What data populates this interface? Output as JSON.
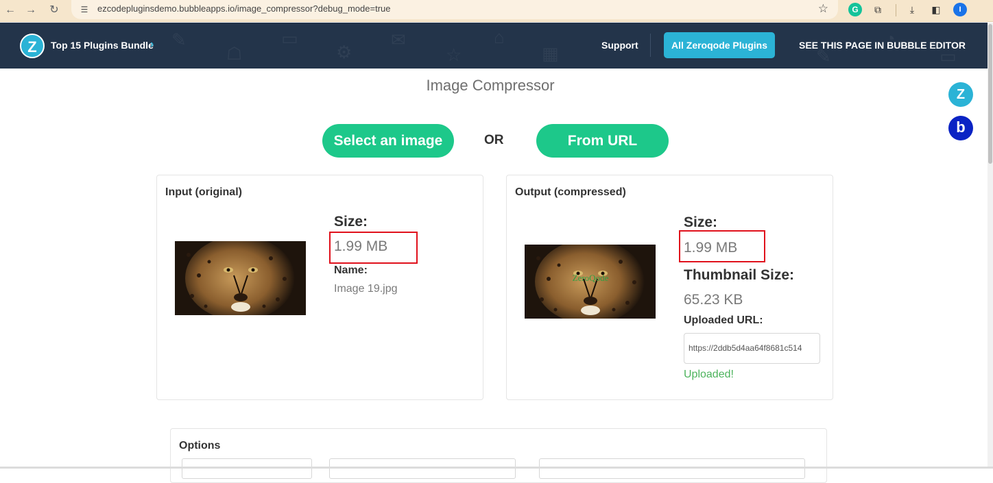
{
  "browser": {
    "url": "ezcodepluginsdemo.bubbleapps.io/image_compressor?debug_mode=true",
    "profile_initial": "I",
    "icons": [
      "back-icon",
      "forward-icon",
      "reload-icon",
      "site-settings-icon",
      "bookmark-star-icon",
      "grammarly-icon",
      "extensions-icon",
      "download-icon",
      "sidebar-icon",
      "profile-icon"
    ]
  },
  "header": {
    "logo_letter": "Z",
    "bundle_label": "Top 15 Plugins Bundle",
    "bundle_chevron": "›",
    "support_label": "Support",
    "all_plugins_label": "All Zeroqode Plugins",
    "editor_label": "SEE THIS PAGE IN BUBBLE EDITOR",
    "colors": {
      "background": "#23344a",
      "accent": "#2bb3d6"
    }
  },
  "page": {
    "title": "Image Compressor",
    "select_button": "Select an image",
    "or_label": "OR",
    "url_button": "From URL",
    "side_z_letter": "Z",
    "side_b_letter": "b",
    "button_color": "#1dc88a"
  },
  "input_card": {
    "title": "Input (original)",
    "size_label": "Size:",
    "size_value": "1.99 MB",
    "name_label": "Name:",
    "name_value": "Image 19.jpg"
  },
  "output_card": {
    "title": "Output (compressed)",
    "size_label": "Size:",
    "size_value": "1.99 MB",
    "thumb_size_label": "Thumbnail Size:",
    "thumb_size_value": "65.23 KB",
    "url_label": "Uploaded URL:",
    "url_value": "https://2ddb5d4aa64f8681c514",
    "status": "Uploaded!",
    "watermark": "ZeroQode"
  },
  "options": {
    "title": "Options"
  }
}
